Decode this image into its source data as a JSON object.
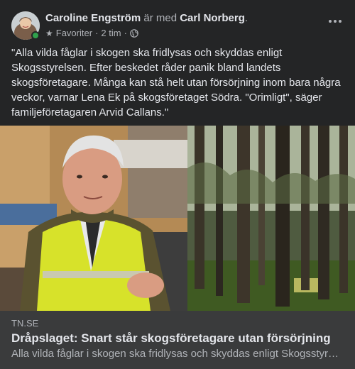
{
  "post": {
    "author": "Caroline Engström",
    "with_text": "är med",
    "tagged": "Carl Norberg",
    "period": ".",
    "audience": "Favoriter",
    "separator": "·",
    "time": "2 tim",
    "separator2": "·",
    "caption": "\"Alla vilda fåglar i skogen ska fridlysas och skyddas enligt Skogsstyrelsen. Efter beskedet råder panik bland landets skogsföretagare. Många kan stå helt utan försörjning inom bara några veckor, varnar Lena Ek på skogsföretaget Södra. \"Orimligt\", säger familjeföretagaren Arvid Callans.\""
  },
  "link": {
    "domain": "TN.SE",
    "title": "Dråpslaget: Snart står skogsföretagare utan försörjning",
    "description": "Alla vilda fåglar i skogen ska fridlysas och skyddas enligt Skogsstyrelsen. Efter beskedet råder panik bland landets skogsföretagare."
  },
  "icons": {
    "star": "star-icon",
    "globe": "globe-icon",
    "more": "more-options-icon"
  },
  "colors": {
    "background": "#242526",
    "text": "#e4e6eb",
    "muted": "#b0b3b8",
    "online": "#31a24c",
    "link_box": "#3a3b3c"
  }
}
